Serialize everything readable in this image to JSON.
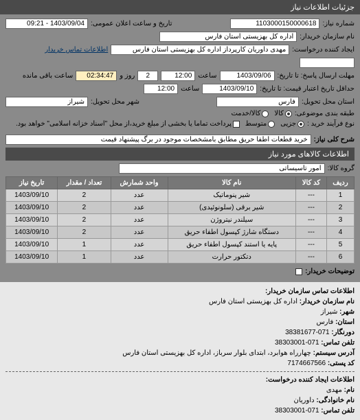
{
  "panel_title": "جزئیات اطلاعات نیاز",
  "request_number": {
    "label": "شماره نیاز:",
    "value": "1103000150000618"
  },
  "announce": {
    "label": "تاریخ و ساعت اعلان عمومی:",
    "value": "1403/09/04 - 09:21"
  },
  "buyer_name": {
    "label": "نام سازمان خریدار:",
    "value": "اداره کل بهزیستی استان فارس"
  },
  "creator": {
    "label": "ایجاد کننده درخواست:",
    "value": "مهدی داوریان کارپرداز اداره کل بهزیستی استان فارس"
  },
  "contact_link": "اطلاعات تماس خریدار",
  "deadline": {
    "label": "مهلت ارسال پاسخ: تا تاریخ:",
    "date": "1403/09/06",
    "time_label": "ساعت",
    "time": "12:00",
    "remain_days": "2",
    "remain_days_label": "روز و",
    "remain_time": "02:34:47",
    "remain_label": "ساعت باقی مانده"
  },
  "validity": {
    "label": "حداقل تاریخ اعتبار قیمت: تا تاریخ:",
    "date": "1403/09/10",
    "time_label": "ساعت",
    "time": "12:00"
  },
  "province": {
    "label": "استان محل تحویل:",
    "value": "فارس"
  },
  "city": {
    "label": "شهر محل تحویل:",
    "value": "شیراز"
  },
  "budget": {
    "label": "طبقه بندی موضوعی:",
    "options": [
      "کالا",
      "کالا/خدمت"
    ],
    "selected": 0
  },
  "purchase_type": {
    "label": "نوع فرآیند خرید :",
    "options": [
      "جزیی",
      "متوسط",
      "پرداخت تماما یا بخشی از مبلغ خرید،از محل \"اسناد خزانه اسلامی\" خواهد بود."
    ],
    "selected": 0
  },
  "description": {
    "label": "شرح کلی نیاز:",
    "value": "خرید قطعات اطفا حریق مطابق بامشخصات موجود در برگ پیشنهاد قیمت"
  },
  "goods_info_title": "اطلاعات کالاهای مورد نیاز",
  "group": {
    "label": "گروه کالا:",
    "value": "امور تاسیساتی"
  },
  "table": {
    "headers": [
      "ردیف",
      "کد کالا",
      "نام کالا",
      "واحد شمارش",
      "تعداد / مقدار",
      "تاریخ نیاز"
    ],
    "rows": [
      [
        "1",
        "---",
        "شیر پنوماتیک",
        "عدد",
        "2",
        "1403/09/10"
      ],
      [
        "2",
        "---",
        "شیر برقی (سلونوئیدی)",
        "عدد",
        "2",
        "1403/09/10"
      ],
      [
        "3",
        "---",
        "سیلندر نیتروژن",
        "عدد",
        "2",
        "1403/09/10"
      ],
      [
        "4",
        "---",
        "دستگاه شارژ کپسول اطفاء حریق",
        "عدد",
        "2",
        "1403/09/10"
      ],
      [
        "5",
        "---",
        "پایه یا استند کپسول اطفاء حریق",
        "عدد",
        "1",
        "1403/09/10"
      ],
      [
        "6",
        "---",
        "دتکتور حرارت",
        "عدد",
        "1",
        "1403/09/10"
      ]
    ]
  },
  "buyer_notes": {
    "label": "توضیحات خریدار:"
  },
  "contact_info_title": "اطلاعات تماس سازمان خریدار:",
  "contact": {
    "org_label": "نام سازمان خریدار:",
    "org": "اداره کل بهزیستی استان فارس",
    "city_label": "شهر:",
    "city": "شیراز",
    "province_label": "استان:",
    "province": "فارس",
    "fax_label": "دورنگار:",
    "fax": "071-38381677",
    "phone_label": "تلفن تماس:",
    "phone": "071-38303001",
    "address_label": "آدرس سیستم:",
    "address": "چهارراه هوابرد، ابتدای بلوار سرباز، اداره کل بهزیستی استان فارس",
    "postal_label": "کد پستی:",
    "postal": "7174667566"
  },
  "creator_info_title": "اطلاعات ایجاد کننده درخواست:",
  "creator_info": {
    "name_label": "نام:",
    "name": "مهدی",
    "surname_label": "نام خانوادگی:",
    "surname": "داوریان",
    "phone_label": "تلفن تماس:",
    "phone": "071-38303001"
  }
}
